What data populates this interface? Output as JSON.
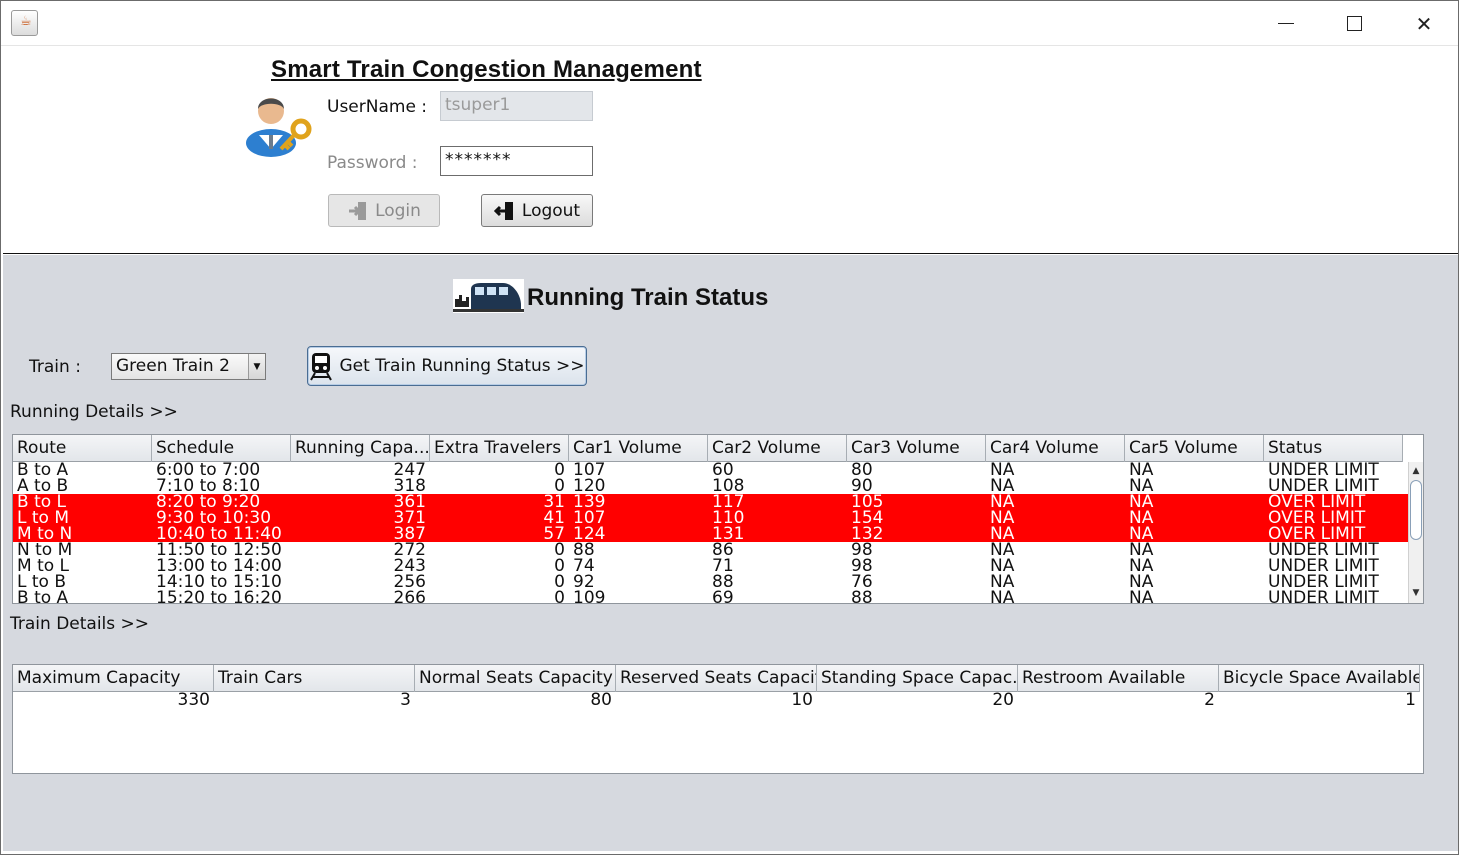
{
  "window": {
    "app_icon_glyph": "☕",
    "minimize": "",
    "maximize": "",
    "close": "✕"
  },
  "login": {
    "title": "Smart Train Congestion Management",
    "username_label": "UserName :",
    "username_value": "tsuper1",
    "password_label": "Password :",
    "password_value": "*******",
    "login_button": "Login",
    "logout_button": "Logout"
  },
  "status": {
    "title": "Running Train Status",
    "train_label": "Train :",
    "train_selected": "Green Train 2",
    "get_status_button": "Get Train Running Status >>",
    "running_details_label": "Running Details >>",
    "train_details_label": "Train Details >>"
  },
  "running_table": {
    "headers": [
      "Route",
      "Schedule",
      "Running Capa...",
      "Extra Travelers",
      "Car1 Volume",
      "Car2 Volume",
      "Car3 Volume",
      "Car4 Volume",
      "Car5 Volume",
      "Status"
    ],
    "rows": [
      {
        "route": "B to A",
        "schedule": "6:00 to 7:00",
        "running": "247",
        "extra": "0",
        "car1": "107",
        "car2": "60",
        "car3": "80",
        "car4": "NA",
        "car5": "NA",
        "status": "UNDER LIMIT",
        "over": false
      },
      {
        "route": "A to B",
        "schedule": "7:10 to 8:10",
        "running": "318",
        "extra": "0",
        "car1": "120",
        "car2": "108",
        "car3": "90",
        "car4": "NA",
        "car5": "NA",
        "status": "UNDER LIMIT",
        "over": false
      },
      {
        "route": "B to L",
        "schedule": "8:20 to 9:20",
        "running": "361",
        "extra": "31",
        "car1": "139",
        "car2": "117",
        "car3": "105",
        "car4": "NA",
        "car5": "NA",
        "status": "OVER LIMIT",
        "over": true
      },
      {
        "route": "L to M",
        "schedule": "9:30 to 10:30",
        "running": "371",
        "extra": "41",
        "car1": "107",
        "car2": "110",
        "car3": "154",
        "car4": "NA",
        "car5": "NA",
        "status": "OVER LIMIT",
        "over": true
      },
      {
        "route": "M to N",
        "schedule": "10:40 to 11:40",
        "running": "387",
        "extra": "57",
        "car1": "124",
        "car2": "131",
        "car3": "132",
        "car4": "NA",
        "car5": "NA",
        "status": "OVER LIMIT",
        "over": true
      },
      {
        "route": "N to M",
        "schedule": "11:50 to 12:50",
        "running": "272",
        "extra": "0",
        "car1": "88",
        "car2": "86",
        "car3": "98",
        "car4": "NA",
        "car5": "NA",
        "status": "UNDER LIMIT",
        "over": false
      },
      {
        "route": "M to L",
        "schedule": "13:00 to 14:00",
        "running": "243",
        "extra": "0",
        "car1": "74",
        "car2": "71",
        "car3": "98",
        "car4": "NA",
        "car5": "NA",
        "status": "UNDER LIMIT",
        "over": false
      },
      {
        "route": "L to B",
        "schedule": "14:10 to 15:10",
        "running": "256",
        "extra": "0",
        "car1": "92",
        "car2": "88",
        "car3": "76",
        "car4": "NA",
        "car5": "NA",
        "status": "UNDER LIMIT",
        "over": false
      },
      {
        "route": "B to A",
        "schedule": "15:20 to 16:20",
        "running": "266",
        "extra": "0",
        "car1": "109",
        "car2": "69",
        "car3": "88",
        "car4": "NA",
        "car5": "NA",
        "status": "UNDER LIMIT",
        "over": false
      }
    ]
  },
  "details_table": {
    "headers": [
      "Maximum Capacity",
      "Train Cars",
      "Normal Seats Capacity",
      "Reserved Seats Capacity",
      "Standing Space Capac...",
      "Restroom Available",
      "Bicycle Space Available"
    ],
    "rows": [
      [
        "330",
        "3",
        "80",
        "10",
        "20",
        "2",
        "1"
      ]
    ]
  }
}
